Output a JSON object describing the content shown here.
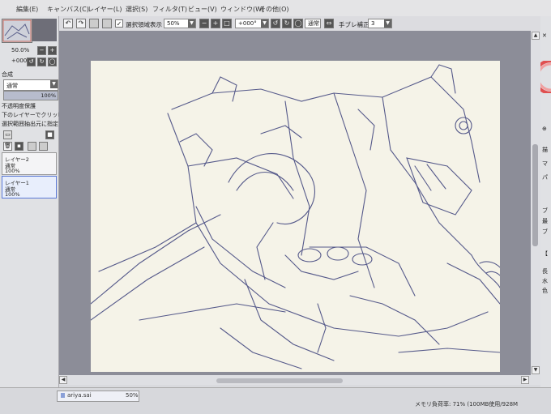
{
  "menubar": {
    "items": [
      "編集(E)",
      "キャンバス(C)",
      "レイヤー(L)",
      "選択(S)",
      "フィルタ(T)",
      "ビュー(V)",
      "ウィンドウ(W)",
      "その他(O)"
    ]
  },
  "toolbar": {
    "selection_checkbox_label": "選択領域表示",
    "zoom_value": "50%",
    "rotation_value": "+000°",
    "blend_mode": "通常",
    "stabilizer_label": "手ブレ補正",
    "stabilizer_value": "3"
  },
  "left_panel": {
    "nav_zoom": "50.0%",
    "nav_angle": "+000°",
    "section_label": "合成",
    "blend_mode": "通常",
    "opacity_value": "100%",
    "option_1": "不透明度保護",
    "option_2": "下のレイヤーでクリッピング",
    "option_3": "選択範囲抽出元に指定",
    "layers": [
      {
        "name": "レイヤー2",
        "mode": "通常",
        "opacity": "100%"
      },
      {
        "name": "レイヤー1",
        "mode": "通常",
        "opacity": "100%"
      }
    ]
  },
  "status": {
    "file_name": "ariya.sai",
    "file_zoom": "50%",
    "memory": "メモリ負荷率: 71% (100MB使用/928M"
  },
  "right_panel": {
    "chars": [
      "描",
      "マ",
      "パ",
      "ブ",
      "最",
      "ブ",
      "【",
      "長",
      "水",
      "色"
    ]
  },
  "colors": {
    "canvas_paper": "#f5f3e8",
    "stroke": "#3a3f7a",
    "workarea_bg": "#8c8d98",
    "selected_layer_border": "#5a78d6"
  }
}
